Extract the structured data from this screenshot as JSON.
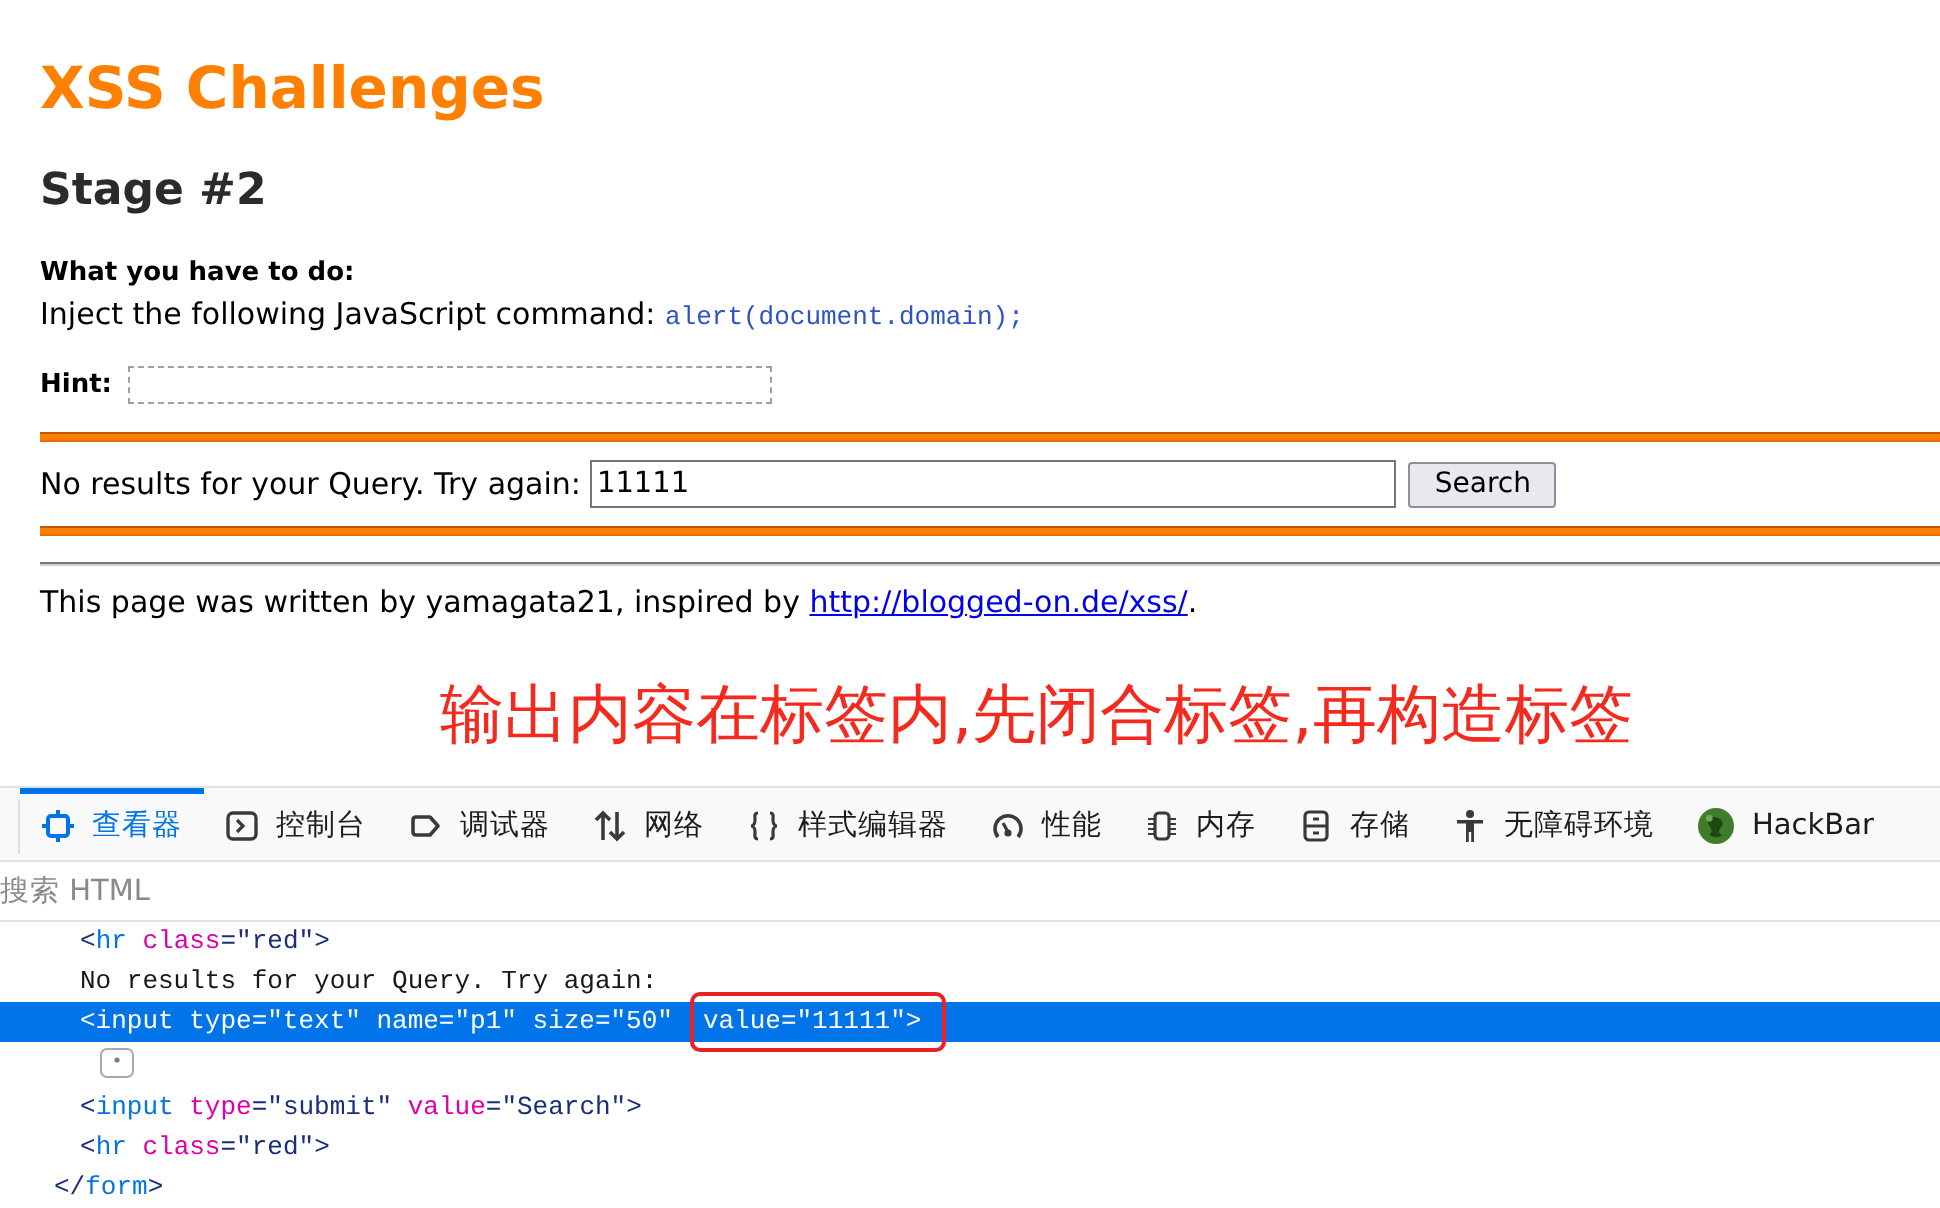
{
  "page": {
    "title": "XSS Challenges",
    "stage": "Stage #2",
    "task": {
      "heading": "What you have to do:",
      "text": "Inject the following JavaScript command:",
      "code": "alert(document.domain);"
    },
    "hint": {
      "label": "Hint:"
    },
    "query": {
      "label": "No results for your Query. Try again:",
      "value": "11111",
      "button": "Search"
    },
    "footer": {
      "text": "This page was written by yamagata21, inspired by",
      "link": "http://blogged-on.de/xss/",
      "end": "."
    }
  },
  "annotation": {
    "text": "输出内容在标签内,先闭合标签,再构造标签"
  },
  "devtools": {
    "tabs": [
      {
        "label": "查看器",
        "selected": true
      },
      {
        "label": "控制台",
        "selected": false
      },
      {
        "label": "调试器",
        "selected": false
      },
      {
        "label": "网络",
        "selected": false
      },
      {
        "label": "样式编辑器",
        "selected": false
      },
      {
        "label": "性能",
        "selected": false
      },
      {
        "label": "内存",
        "selected": false
      },
      {
        "label": "存储",
        "selected": false
      },
      {
        "label": "无障碍环境",
        "selected": false
      },
      {
        "label": "HackBar",
        "selected": false
      }
    ],
    "search": {
      "placeholder": "搜索 HTML"
    },
    "markup": [
      {
        "kind": "node",
        "selected": false,
        "children": [
          {
            "kind": "code",
            "selected": false,
            "tokens": [
              {
                "kind": "punct",
                "text": "<"
              },
              {
                "kind": "tag",
                "text": "hr"
              },
              {
                "kind": "attr",
                "text": " class"
              },
              {
                "kind": "punct",
                "text": "="
              },
              {
                "kind": "value",
                "text": "\"red\""
              },
              {
                "kind": "punct",
                "text": ">"
              }
            ]
          },
          {
            "kind": "code",
            "selected": false,
            "tokens": [
              {
                "kind": "text",
                "text": "No results for your Query. Try again:"
              }
            ]
          },
          {
            "kind": "code",
            "selected": true,
            "tokens": [
              {
                "text": "<input type=\"text\" name=\"p1\" size=\"50\""
              }
            ],
            "boxed_tokens": [
              {
                "text": "value=\"11111\">"
              }
            ]
          },
          {
            "kind": "whitespace",
            "selected": false
          },
          {
            "kind": "code",
            "selected": false,
            "tokens": [
              {
                "kind": "punct",
                "text": "<"
              },
              {
                "kind": "tag",
                "text": "input"
              },
              {
                "kind": "attr",
                "text": " type"
              },
              {
                "kind": "punct",
                "text": "="
              },
              {
                "kind": "value",
                "text": "\"submit\""
              },
              {
                "kind": "attr",
                "text": " value"
              },
              {
                "kind": "punct",
                "text": "="
              },
              {
                "kind": "value",
                "text": "\"Search\""
              },
              {
                "kind": "punct",
                "text": ">"
              }
            ]
          },
          {
            "kind": "code",
            "selected": false,
            "tokens": [
              {
                "kind": "punct",
                "text": "<"
              },
              {
                "kind": "tag",
                "text": "hr"
              },
              {
                "kind": "attr",
                "text": " class"
              },
              {
                "kind": "punct",
                "text": "="
              },
              {
                "kind": "value",
                "text": "\"red\""
              },
              {
                "kind": "punct",
                "text": ">"
              }
            ]
          }
        ],
        "closing_tokens": [
          {
            "kind": "punct",
            "text": "</"
          },
          {
            "kind": "tag",
            "text": "form"
          },
          {
            "kind": "punct",
            "text": ">"
          }
        ]
      }
    ]
  }
}
